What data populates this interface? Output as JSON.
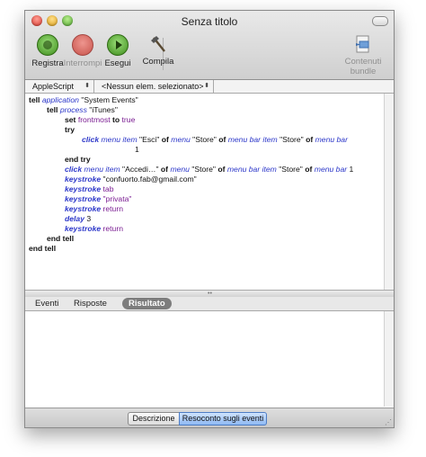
{
  "window": {
    "title": "Senza titolo"
  },
  "toolbar": {
    "record": "Registra",
    "stop": "Interrompi",
    "run": "Esegui",
    "compile": "Compila",
    "bundle": "Contenuti bundle"
  },
  "selectors": {
    "language": "AppleScript",
    "element": "<Nessun elem. selezionato>"
  },
  "code": {
    "l1a": "tell",
    "l1b": "application",
    "l1c": "\"System Events\"",
    "l2a": "tell",
    "l2b": "process",
    "l2c": "\"iTunes\"",
    "l3a": "set",
    "l3b": "frontmost",
    "l3c": "to",
    "l3d": "true",
    "l4a": "try",
    "l5a": "click",
    "l5b": "menu item",
    "l5c": "\"Esci\"",
    "l5d": "of",
    "l5e": "menu",
    "l5f": "\"Store\"",
    "l5g": "of",
    "l5h": "menu bar item",
    "l5i": "\"Store\"",
    "l5j": "of",
    "l5k": "menu bar",
    "l6a": "1",
    "l7a": "end try",
    "l8a": "click",
    "l8b": "menu item",
    "l8c": "\"Accedi…\"",
    "l8d": "of",
    "l8e": "menu",
    "l8f": "\"Store\"",
    "l8g": "of",
    "l8h": "menu bar item",
    "l8i": "\"Store\"",
    "l8j": "of",
    "l8k": "menu bar",
    "l8l": "1",
    "l9a": "keystroke",
    "l9b": "\"confuorto.fab@gmail.com\"",
    "l10a": "keystroke",
    "l10b": "tab",
    "l11a": "keystroke",
    "l11b": "\"privata\"",
    "l12a": "keystroke",
    "l12b": "return",
    "l13a": "delay",
    "l13b": "3",
    "l14a": "keystroke",
    "l14b": "return",
    "l15a": "end tell",
    "l16a": "end tell"
  },
  "tabs": {
    "events": "Eventi",
    "replies": "Risposte",
    "result": "Risultato"
  },
  "bottom": {
    "description": "Descrizione",
    "log": "Resoconto sugli eventi"
  },
  "colors": {
    "keyword": "#111111",
    "application_term": "#2c37c9",
    "variable": "#7a1c92"
  }
}
